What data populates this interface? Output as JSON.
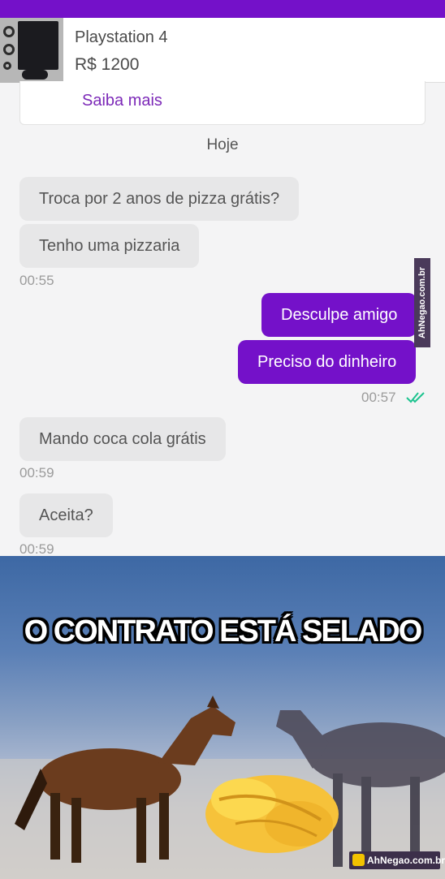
{
  "product": {
    "name": "Playstation 4",
    "price": "R$ 1200",
    "more_link": "Saiba mais"
  },
  "chat": {
    "day_label": "Hoje",
    "messages": [
      {
        "text": "Troca por 2 anos de pizza grátis?",
        "direction": "in"
      },
      {
        "text": "Tenho uma pizzaria",
        "direction": "in",
        "time": "00:55"
      },
      {
        "text": "Desculpe amigo",
        "direction": "out"
      },
      {
        "text": "Preciso do dinheiro",
        "direction": "out",
        "time": "00:57",
        "status": "read"
      },
      {
        "text": "Mando coca cola grátis",
        "direction": "in",
        "time": "00:59"
      },
      {
        "text": "Aceita?",
        "direction": "in",
        "time": "00:59"
      }
    ]
  },
  "meme": {
    "caption": "O CONTRATO ESTÁ SELADO"
  },
  "watermarks": {
    "side": "AhNegao.com.br",
    "bottom": "AhNegao.com.br"
  },
  "colors": {
    "accent": "#7411c9",
    "incoming_bubble": "#e7e7e8",
    "read_ticks": "#1bc38e"
  },
  "icons": {
    "read_receipt": "double-check-icon",
    "product_thumbnail": "playstation-photo",
    "handshake": "handshake-emoji"
  }
}
